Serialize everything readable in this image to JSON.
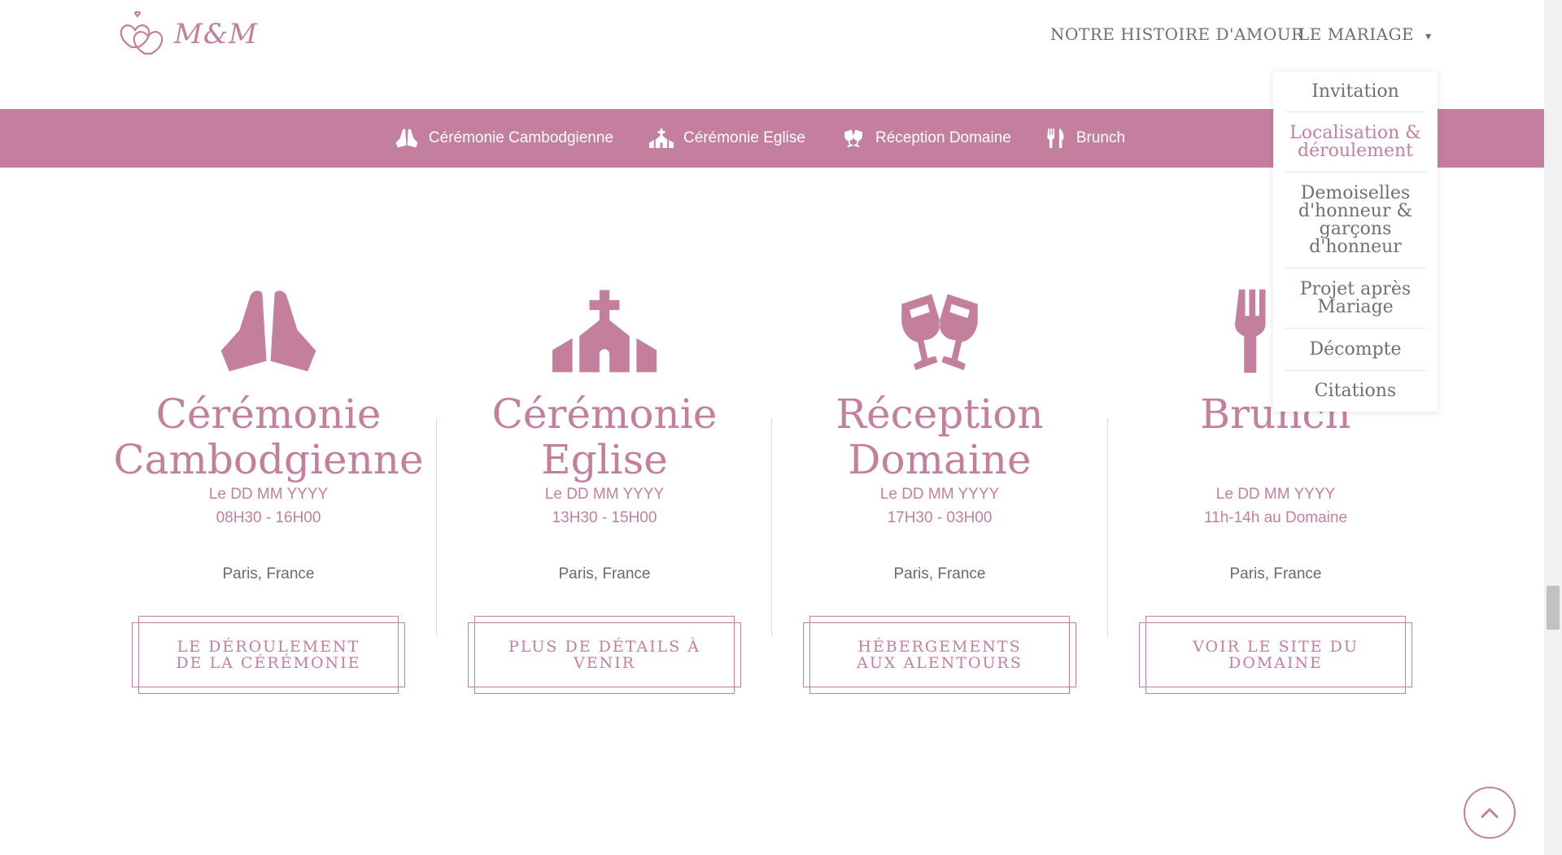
{
  "brand": {
    "logo_text": "M&M"
  },
  "nav": {
    "histoire_label": "NOTRE HISTOIRE D'AMOUR",
    "mariage_label": "LE MARIAGE",
    "mariage_caret": "⌄"
  },
  "subnav": {
    "items": [
      {
        "label": "Cérémonie Cambodgienne",
        "icon": "praying-hands-icon"
      },
      {
        "label": "Cérémonie Eglise",
        "icon": "church-icon"
      },
      {
        "label": "Réception Domaine",
        "icon": "glasses-cheers-icon"
      },
      {
        "label": "Brunch",
        "icon": "utensils-icon"
      }
    ]
  },
  "dropdown": {
    "items": [
      {
        "label": "Invitation",
        "active": false
      },
      {
        "label": "Localisation & déroulement",
        "active": true
      },
      {
        "label": "Demoiselles d'honneur & garçons d'honneur",
        "active": false
      },
      {
        "label": "Projet après Mariage",
        "active": false
      },
      {
        "label": "Décompte",
        "active": false
      },
      {
        "label": "Citations",
        "active": false
      }
    ]
  },
  "events": [
    {
      "icon": "praying-hands-icon",
      "title_line1": "Cérémonie",
      "title_line2": "Cambodgienne",
      "date": "Le DD MM YYYY",
      "time": "08H30 - 16H00",
      "place": "Paris, France",
      "button_label": "LE DÉROULEMENT DE LA CÉRÉMONIE"
    },
    {
      "icon": "church-icon",
      "title_line1": "Cérémonie",
      "title_line2": "Eglise",
      "date": "Le DD MM YYYY",
      "time": "13H30 - 15H00",
      "place": "Paris, France",
      "button_label": "PLUS DE DÉTAILS À VENIR"
    },
    {
      "icon": "glasses-cheers-icon",
      "title_line1": "Réception",
      "title_line2": "Domaine",
      "date": "Le DD MM YYYY",
      "time": "17H30 - 03H00",
      "place": "Paris, France",
      "button_label": "HÉBERGEMENTS AUX ALENTOURS"
    },
    {
      "icon": "utensils-icon",
      "title_line1": "Brunch",
      "title_line2": "",
      "date": "Le DD MM YYYY",
      "time": "11h-14h au Domaine",
      "place": "Paris, France",
      "button_label": "VOIR LE SITE DU DOMAINE"
    }
  ],
  "colors": {
    "accent": "#c57f9e",
    "text_gray": "#6f6f6f",
    "background": "#ffffff"
  },
  "back_to_top": {
    "icon": "chevron-up-icon"
  }
}
